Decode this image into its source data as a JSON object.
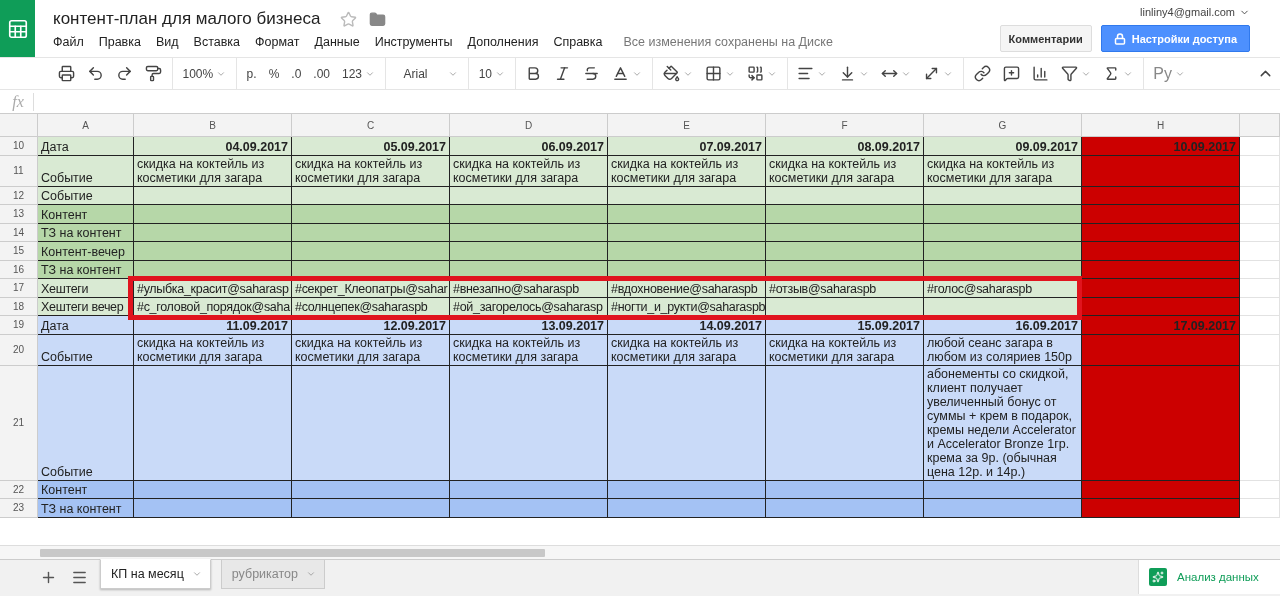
{
  "app": {
    "title": "контент-план для малого бизнеса",
    "menu": [
      "Файл",
      "Правка",
      "Вид",
      "Вставка",
      "Формат",
      "Данные",
      "Инструменты",
      "Дополнения",
      "Справка"
    ],
    "save_status": "Все изменения сохранены на Диске",
    "account": "linliny4@gmail.com",
    "comments_button": "Комментарии",
    "share_button": "Настройки доступа"
  },
  "toolbar": {
    "zoom": "100%",
    "currency": "р.",
    "percent": "%",
    "decrease_decimals": ".0",
    "increase_decimals": ".00",
    "number_format": "123",
    "font": "Arial",
    "font_size": "10",
    "input_tools": "Ру"
  },
  "formula_bar": {
    "label": "fx"
  },
  "sheet": {
    "columns": [
      "A",
      "B",
      "C",
      "D",
      "E",
      "F",
      "G",
      "H"
    ],
    "rows": [
      {
        "num": "10",
        "kind": "date",
        "color": "#d9ead3",
        "cells": [
          "Дата",
          "04.09.2017",
          "05.09.2017",
          "06.09.2017",
          "07.09.2017",
          "08.09.2017",
          "09.09.2017"
        ],
        "last": {
          "text": "10.09.2017",
          "color": "#cc0000"
        }
      },
      {
        "num": "11",
        "kind": "text",
        "color": "#d9ead3",
        "cells": [
          "Событие",
          "скидка на коктейль из косметики для загара",
          "скидка на коктейль из косметики для загара",
          "скидка на коктейль из косметики для загара",
          "скидка на коктейль из косметики для загара",
          "скидка на коктейль из косметики для загара",
          "скидка на коктейль из косметики для загара"
        ],
        "last": {
          "color": "#cc0000"
        }
      },
      {
        "num": "12",
        "kind": "text",
        "color": "#d9ead3",
        "cells": [
          "Событие",
          null,
          null,
          null,
          null,
          null,
          null
        ],
        "last": {
          "color": "#cc0000"
        }
      },
      {
        "num": "13",
        "kind": "text",
        "color": "#b6d7a8",
        "cells": [
          "Контент",
          null,
          null,
          null,
          null,
          null,
          null
        ],
        "last": {
          "color": "#cc0000"
        }
      },
      {
        "num": "14",
        "kind": "text",
        "color": "#b6d7a8",
        "cells": [
          "ТЗ на контент",
          null,
          null,
          null,
          null,
          null,
          null
        ],
        "last": {
          "color": "#cc0000"
        }
      },
      {
        "num": "15",
        "kind": "text",
        "color": "#b6d7a8",
        "cells": [
          "Контент-вечер",
          null,
          null,
          null,
          null,
          null,
          null
        ],
        "last": {
          "color": "#cc0000"
        }
      },
      {
        "num": "16",
        "kind": "text",
        "color": "#b6d7a8",
        "cells": [
          "ТЗ на контент",
          null,
          null,
          null,
          null,
          null,
          null
        ],
        "last": {
          "color": "#cc0000"
        }
      },
      {
        "num": "17",
        "kind": "tag",
        "color": "#d9ead3",
        "cells": [
          "Хештеги",
          "#улыбка_красит@saharasp",
          "#секрет_Клеопатры@sahar",
          "#внезапно@saharaspb",
          "#вдохновение@saharaspb",
          "#отзыв@saharaspb",
          "#голос@saharaspb"
        ],
        "last": {
          "color": "#cc0000"
        }
      },
      {
        "num": "18",
        "kind": "tag",
        "color": "#d9ead3",
        "cells": [
          "Хештеги вечер",
          "#с_головой_порядок@saha",
          "#солнцепек@saharaspb",
          "#ой_загорелось@saharasp",
          "#ногти_и_рукти@saharaspb",
          null,
          null
        ],
        "last": {
          "color": "#cc0000"
        }
      },
      {
        "num": "19",
        "kind": "date",
        "color": "#c9daf8",
        "cells": [
          "Дата",
          "11.09.2017",
          "12.09.2017",
          "13.09.2017",
          "14.09.2017",
          "15.09.2017",
          "16.09.2017"
        ],
        "last": {
          "text": "17.09.2017",
          "color": "#cc0000"
        }
      },
      {
        "num": "20",
        "kind": "text",
        "color": "#c9daf8",
        "cells": [
          "Событие",
          "скидка на коктейль из косметики для загара",
          "скидка на коктейль из косметики для загара",
          "скидка на коктейль из косметики для загара",
          "скидка на коктейль из косметики для загара",
          "скидка на коктейль из косметики для загара",
          "любой сеанс загара в любом из соляриев 150р"
        ],
        "last": {
          "color": "#cc0000"
        }
      },
      {
        "num": "21",
        "kind": "text",
        "color": "#c9daf8",
        "cells": [
          "Событие",
          null,
          null,
          null,
          null,
          null,
          "абонементы со скидкой, клиент получает увеличенный бонус от суммы + крем в подарок, кремы недели Accelerator и Accelerator Bronze 1гр. крема за 9р. (обычная цена 12р. и 14р.)"
        ],
        "last": {
          "color": "#cc0000"
        }
      },
      {
        "num": "22",
        "kind": "text",
        "color": "#a4c2f4",
        "cells": [
          "Контент",
          null,
          null,
          null,
          null,
          null,
          null
        ],
        "last": {
          "color": "#cc0000"
        }
      },
      {
        "num": "23",
        "kind": "text",
        "color": "#a4c2f4",
        "cells": [
          "ТЗ на контент",
          null,
          null,
          null,
          null,
          null,
          null
        ],
        "last": {
          "color": "#cc0000"
        }
      }
    ]
  },
  "sheet_tabs": [
    {
      "label": "КП на месяц",
      "selected": true
    },
    {
      "label": "рубрикатор",
      "selected": false
    }
  ],
  "explore_button": "Анализ данных"
}
